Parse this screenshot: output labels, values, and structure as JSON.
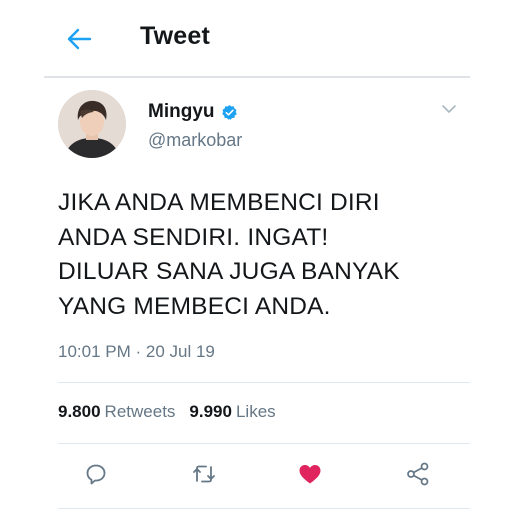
{
  "header": {
    "title": "Tweet",
    "back_icon": "arrow-left-icon"
  },
  "author": {
    "name": "Mingyu",
    "handle": "@markobar",
    "verified": true,
    "verified_icon": "verified-badge-icon"
  },
  "tweet": {
    "lines": [
      "JIKA ANDA MEMBENCI DIRI",
      "ANDA SENDIRI. INGAT!",
      "DILUAR SANA JUGA BANYAK",
      "YANG MEMBECI ANDA."
    ],
    "timestamp": "10:01 PM · 20 Jul 19"
  },
  "stats": {
    "retweets_count": "9.800",
    "retweets_label": "Retweets",
    "likes_count": "9.990",
    "likes_label": "Likes"
  },
  "actions": {
    "reply_icon": "reply-icon",
    "retweet_icon": "retweet-icon",
    "like_icon": "heart-icon",
    "like_active": true,
    "share_icon": "share-icon"
  },
  "colors": {
    "accent": "#1da1f2",
    "like": "#e0245e",
    "secondary_text": "#657786",
    "primary_text": "#14171a"
  }
}
